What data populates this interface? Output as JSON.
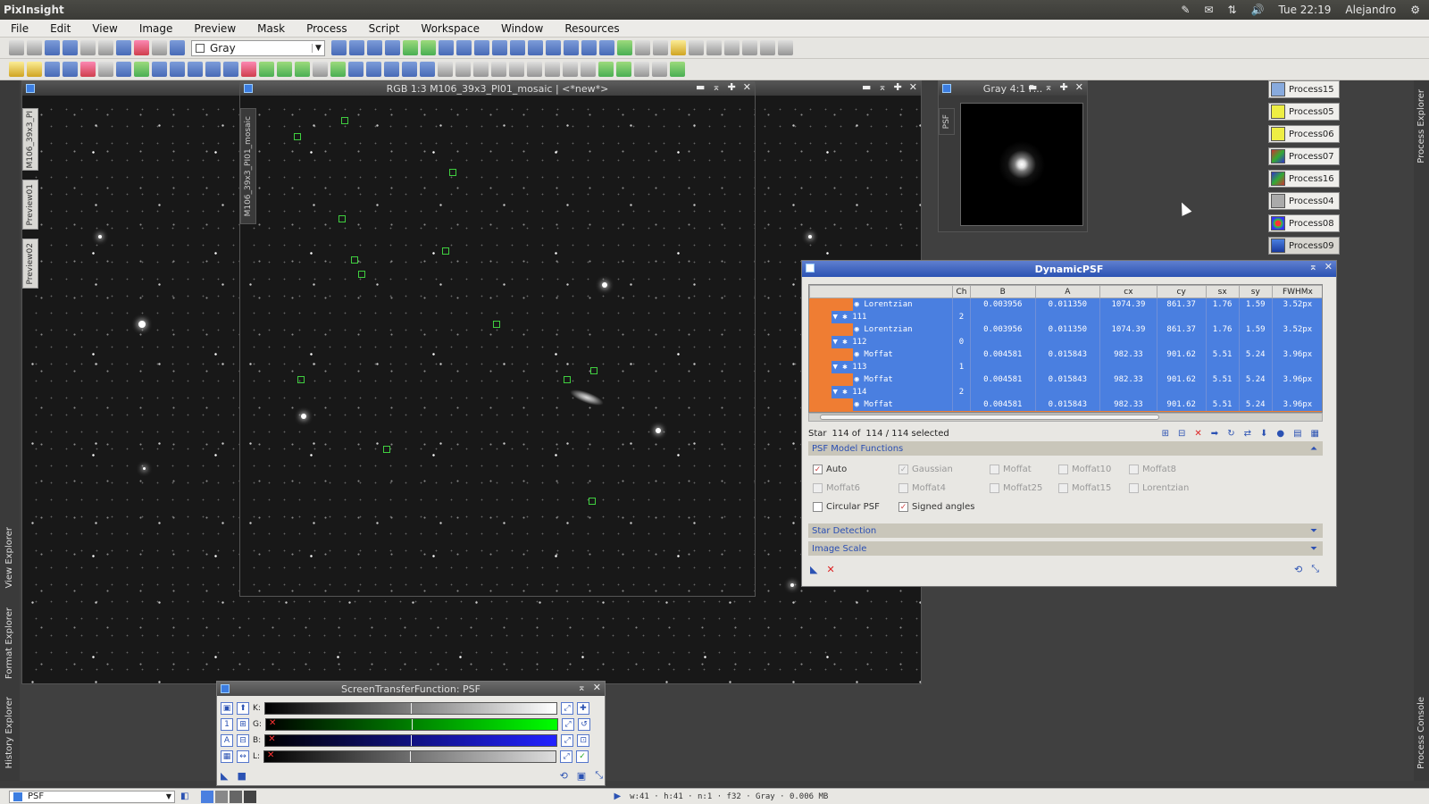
{
  "system": {
    "app_name": "PixInsight",
    "clock": "Tue 22:19",
    "user": "Alejandro"
  },
  "menu": [
    "File",
    "Edit",
    "View",
    "Image",
    "Preview",
    "Mask",
    "Process",
    "Script",
    "Workspace",
    "Window",
    "Resources"
  ],
  "toolbar": {
    "channel_combo": "Gray"
  },
  "left_panels": {
    "view_explorer": "View Explorer",
    "format_explorer": "Format Explorer",
    "history_explorer": "History Explorer"
  },
  "right_panels": {
    "process_explorer": "Process Explorer",
    "process_console": "Process Console"
  },
  "main_window": {
    "title": "M106_39x3_PI",
    "tabs": [
      "M106_39x3_PI",
      "Preview01",
      "Preview02"
    ]
  },
  "mosaic_window": {
    "title": "RGB 1:3 M106_39x3_PI01_mosaic | <*new*>",
    "side_label": "M106_39x3_PI01_mosaic"
  },
  "psf_window": {
    "title": "Gray 4:1 P...",
    "tab": "PSF"
  },
  "process_icons": [
    "Process15",
    "Process05",
    "Process06",
    "Process07",
    "Process16",
    "Process04",
    "Process08",
    "Process09"
  ],
  "dynamic_psf": {
    "title": "DynamicPSF",
    "columns": [
      "",
      "Ch",
      "B",
      "A",
      "cx",
      "cy",
      "sx",
      "sy",
      "FWHMx"
    ],
    "rows": [
      {
        "name": "Lorentzian",
        "ch": "",
        "b": "0.003956",
        "a": "0.011350",
        "cx": "1074.39",
        "cy": "861.37",
        "sx": "1.76",
        "sy": "1.59",
        "fwhm": "3.52px",
        "kind": "func"
      },
      {
        "name": "111",
        "ch": "2",
        "b": "",
        "a": "",
        "cx": "",
        "cy": "",
        "sx": "",
        "sy": "",
        "fwhm": "",
        "kind": "star"
      },
      {
        "name": "Lorentzian",
        "ch": "",
        "b": "0.003956",
        "a": "0.011350",
        "cx": "1074.39",
        "cy": "861.37",
        "sx": "1.76",
        "sy": "1.59",
        "fwhm": "3.52px",
        "kind": "func"
      },
      {
        "name": "112",
        "ch": "0",
        "b": "",
        "a": "",
        "cx": "",
        "cy": "",
        "sx": "",
        "sy": "",
        "fwhm": "",
        "kind": "star"
      },
      {
        "name": "Moffat",
        "ch": "",
        "b": "0.004581",
        "a": "0.015843",
        "cx": "982.33",
        "cy": "901.62",
        "sx": "5.51",
        "sy": "5.24",
        "fwhm": "3.96px",
        "kind": "func"
      },
      {
        "name": "113",
        "ch": "1",
        "b": "",
        "a": "",
        "cx": "",
        "cy": "",
        "sx": "",
        "sy": "",
        "fwhm": "",
        "kind": "star"
      },
      {
        "name": "Moffat",
        "ch": "",
        "b": "0.004581",
        "a": "0.015843",
        "cx": "982.33",
        "cy": "901.62",
        "sx": "5.51",
        "sy": "5.24",
        "fwhm": "3.96px",
        "kind": "func"
      },
      {
        "name": "114",
        "ch": "2",
        "b": "",
        "a": "",
        "cx": "",
        "cy": "",
        "sx": "",
        "sy": "",
        "fwhm": "",
        "kind": "star"
      },
      {
        "name": "Moffat",
        "ch": "",
        "b": "0.004581",
        "a": "0.015843",
        "cx": "982.33",
        "cy": "901.62",
        "sx": "5.51",
        "sy": "5.24",
        "fwhm": "3.96px",
        "kind": "func"
      }
    ],
    "status": {
      "star_label": "Star",
      "star_index": "114 of",
      "selected": "114 / 114 selected"
    },
    "sections": {
      "psf_models": "PSF Model Functions",
      "star_detection": "Star Detection",
      "image_scale": "Image Scale"
    },
    "checkboxes": [
      {
        "label": "Auto",
        "checked": true,
        "enabled": true
      },
      {
        "label": "Gaussian",
        "checked": true,
        "enabled": false
      },
      {
        "label": "Moffat",
        "checked": false,
        "enabled": false
      },
      {
        "label": "Moffat10",
        "checked": false,
        "enabled": false
      },
      {
        "label": "Moffat8",
        "checked": false,
        "enabled": false
      },
      {
        "label": "Moffat6",
        "checked": false,
        "enabled": false
      },
      {
        "label": "Moffat4",
        "checked": false,
        "enabled": false
      },
      {
        "label": "Moffat25",
        "checked": false,
        "enabled": false
      },
      {
        "label": "Moffat15",
        "checked": false,
        "enabled": false
      },
      {
        "label": "Lorentzian",
        "checked": false,
        "enabled": false
      },
      {
        "label": "Circular PSF",
        "checked": false,
        "enabled": true
      },
      {
        "label": "Signed angles",
        "checked": true,
        "enabled": true
      }
    ]
  },
  "stf": {
    "title": "ScreenTransferFunction: PSF",
    "channels": [
      "K:",
      "G:",
      "B:",
      "L:"
    ]
  },
  "statusbar": {
    "view": "PSF",
    "info": "w:41 · h:41 · n:1 · f32 · Gray · 0.006 MB"
  }
}
